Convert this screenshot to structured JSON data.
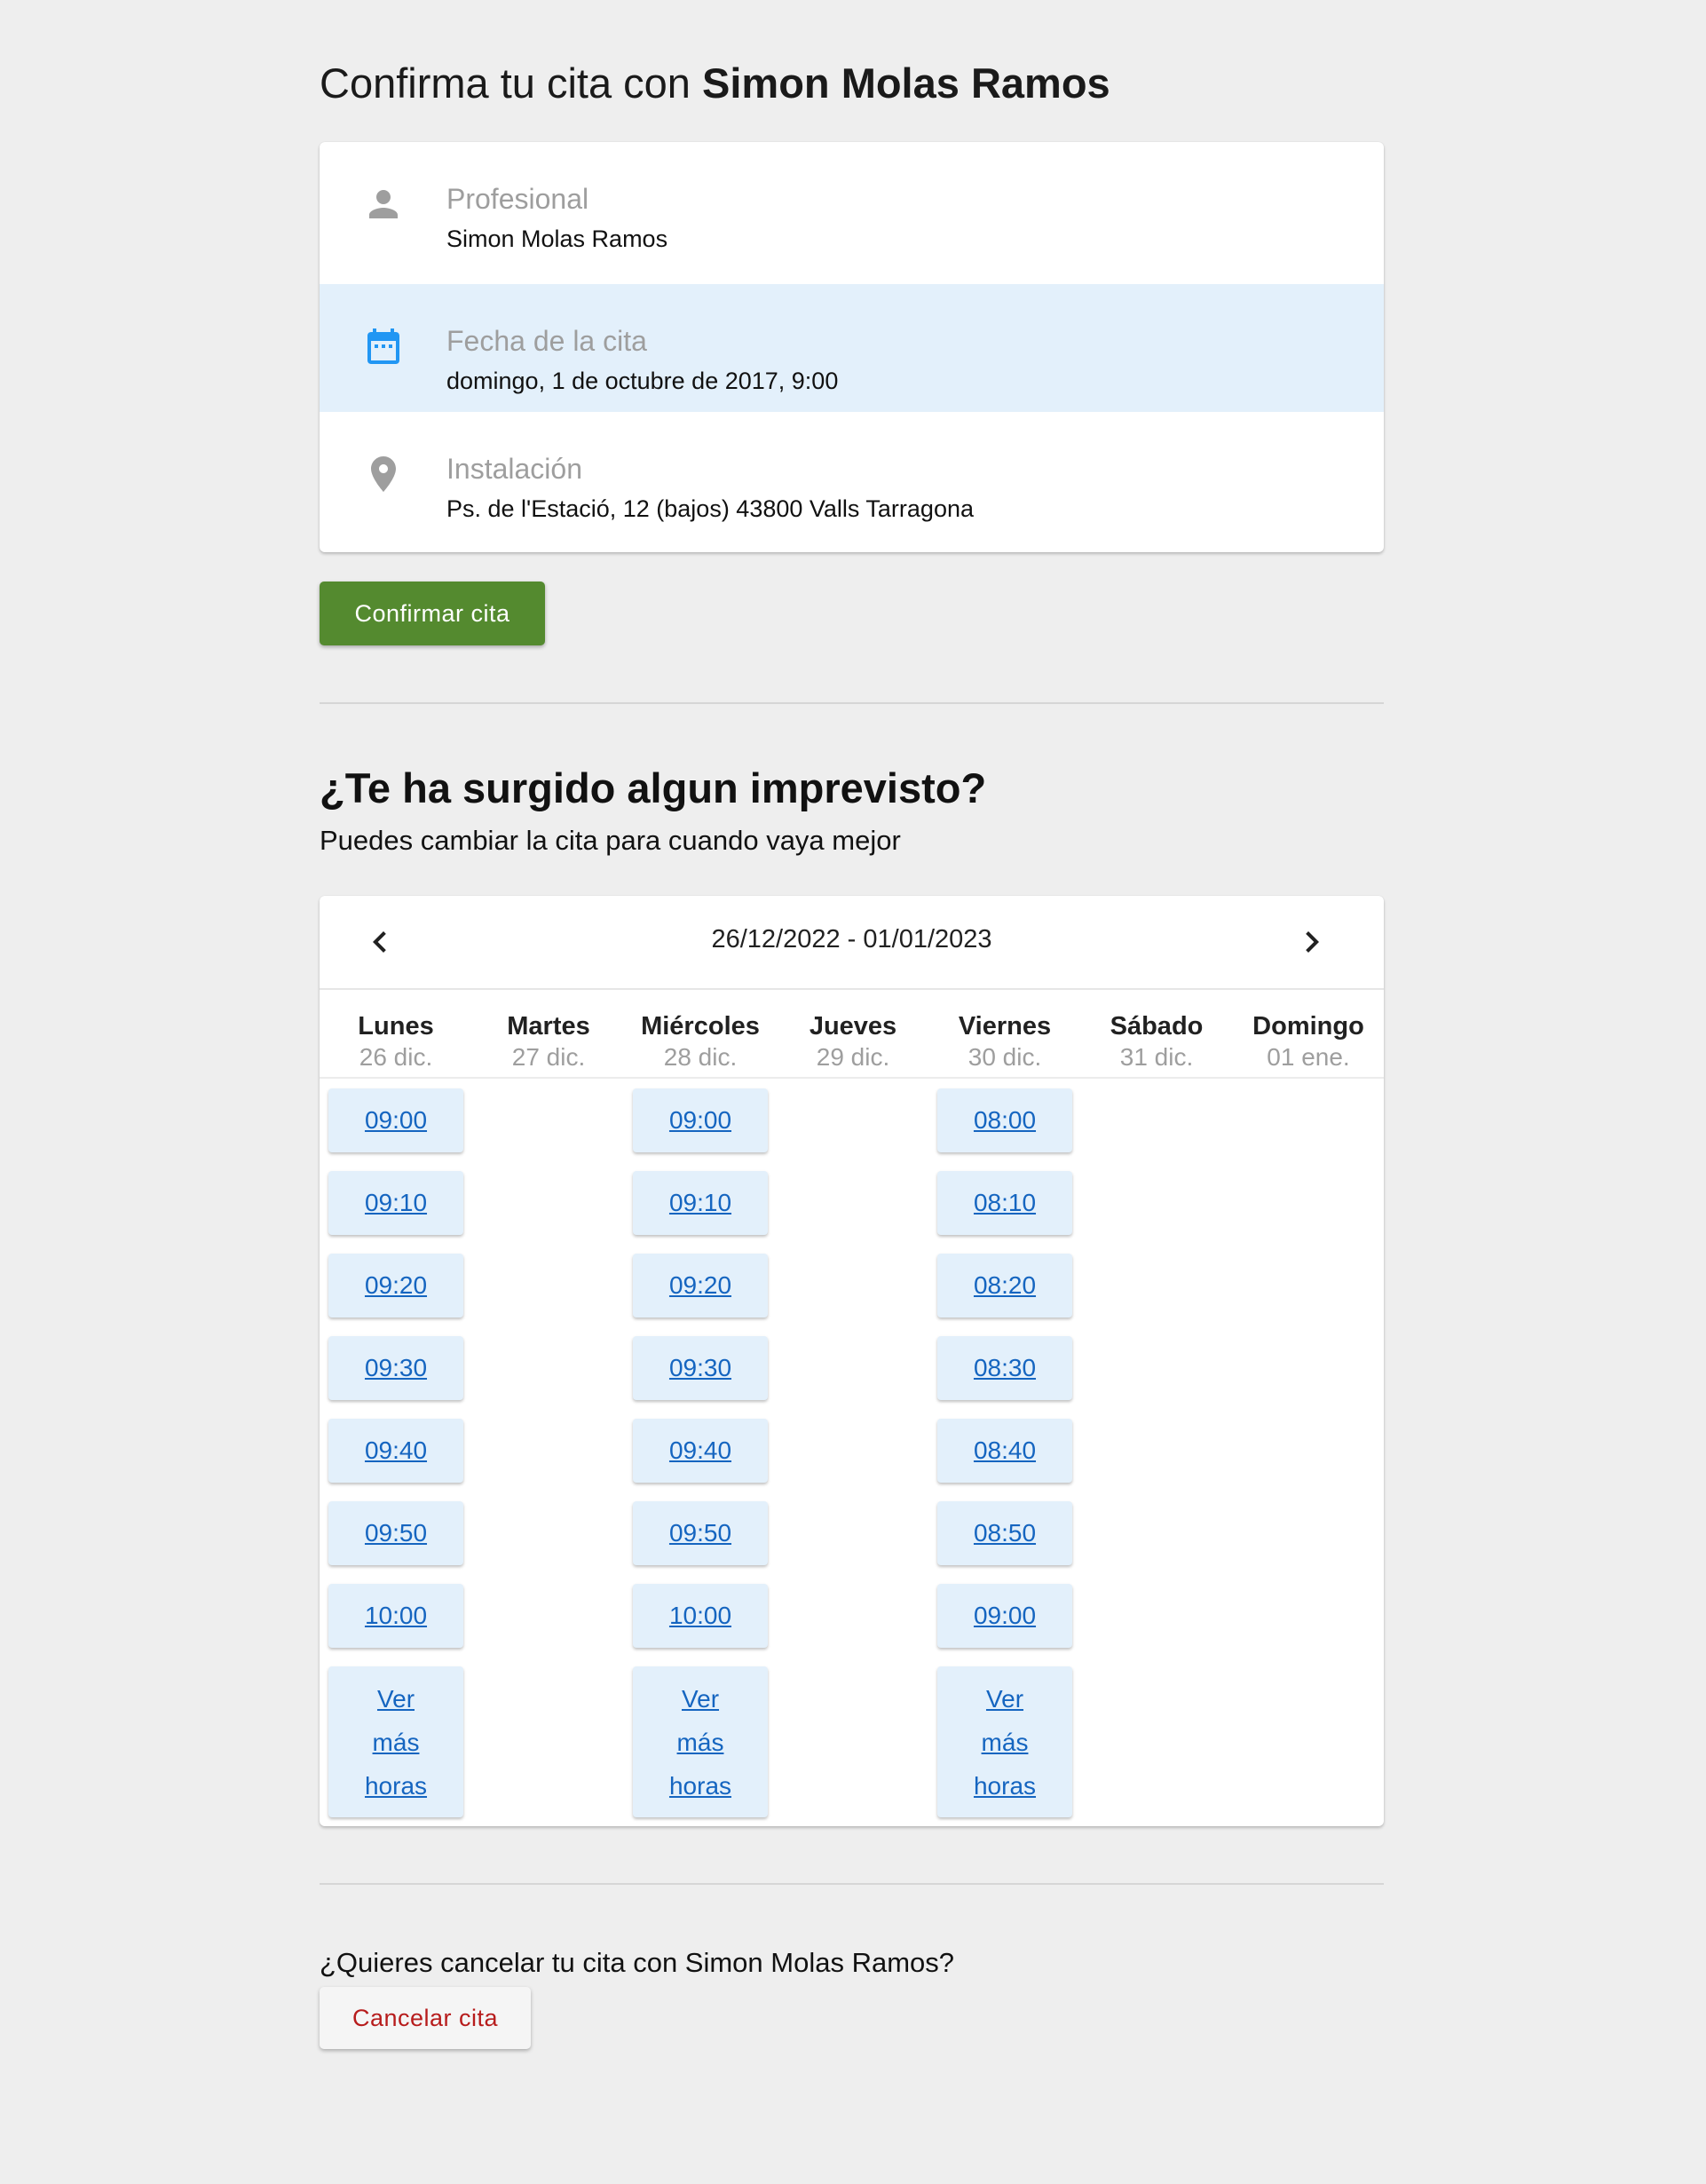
{
  "header": {
    "title_prefix": "Confirma tu cita con",
    "professional_name": "Simon Molas Ramos"
  },
  "details": {
    "professional": {
      "label": "Profesional",
      "value": "Simon Molas Ramos",
      "icon": "person-icon"
    },
    "date": {
      "label": "Fecha de la cita",
      "value": "domingo, 1 de octubre de 2017, 9:00",
      "icon": "calendar-icon"
    },
    "location": {
      "label": "Instalación",
      "value": "Ps. de l'Estació, 12 (bajos) 43800 Valls Tarragona",
      "icon": "location-pin-icon"
    }
  },
  "confirm_button": "Confirmar cita",
  "reschedule": {
    "heading": "¿Te ha surgido algun imprevisto?",
    "subtitle": "Puedes cambiar la cita para cuando vaya mejor"
  },
  "calendar": {
    "range": "26/12/2022 - 01/01/2023",
    "days": [
      {
        "name": "Lunes",
        "date": "26 dic.",
        "slots": [
          "09:00",
          "09:10",
          "09:20",
          "09:30",
          "09:40",
          "09:50",
          "10:00"
        ],
        "more": [
          "Ver",
          "más",
          "horas"
        ]
      },
      {
        "name": "Martes",
        "date": "27 dic.",
        "slots": [],
        "more": []
      },
      {
        "name": "Miércoles",
        "date": "28 dic.",
        "slots": [
          "09:00",
          "09:10",
          "09:20",
          "09:30",
          "09:40",
          "09:50",
          "10:00"
        ],
        "more": [
          "Ver",
          "más",
          "horas"
        ]
      },
      {
        "name": "Jueves",
        "date": "29 dic.",
        "slots": [],
        "more": []
      },
      {
        "name": "Viernes",
        "date": "30 dic.",
        "slots": [
          "08:00",
          "08:10",
          "08:20",
          "08:30",
          "08:40",
          "08:50",
          "09:00"
        ],
        "more": [
          "Ver",
          "más",
          "horas"
        ]
      },
      {
        "name": "Sábado",
        "date": "31 dic.",
        "slots": [],
        "more": []
      },
      {
        "name": "Domingo",
        "date": "01 ene.",
        "slots": [],
        "more": []
      }
    ]
  },
  "cancel": {
    "question": "¿Quieres cancelar tu cita con Simon Molas Ramos?",
    "button": "Cancelar cita"
  },
  "colors": {
    "confirm": "#548a2f",
    "cancel_text": "#b71c1c",
    "slot_bg": "#e3f0fb",
    "slot_text": "#1565c0",
    "accent_icon": "#2196f3"
  }
}
